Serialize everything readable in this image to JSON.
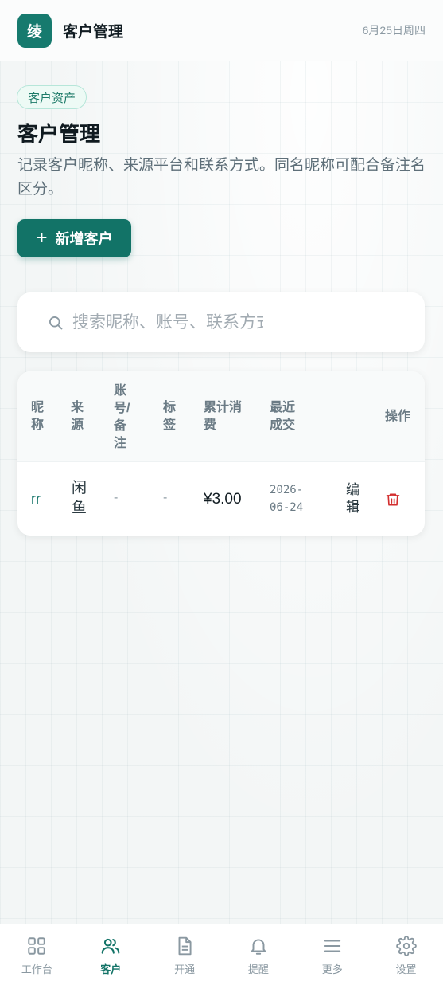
{
  "header": {
    "logo_text": "绫",
    "title": "客户管理",
    "date": "6月25日周四"
  },
  "page": {
    "badge": "客户资产",
    "title": "客户管理",
    "description": "记录客户昵称、来源平台和联系方式。同名昵称可配合备注名区分。",
    "add_button": "新增客户"
  },
  "search": {
    "placeholder": "搜索昵称、账号、联系方式"
  },
  "table": {
    "headers": {
      "nickname": [
        "昵",
        "称"
      ],
      "source": [
        "来",
        "源"
      ],
      "account": [
        "账",
        "号/",
        "备",
        "注"
      ],
      "tag": [
        "标",
        "签"
      ],
      "total": [
        "累计消",
        "费"
      ],
      "recent": [
        "最近",
        "成交"
      ],
      "action": "操作"
    },
    "rows": [
      {
        "nickname": "rr",
        "source": [
          "闲",
          "鱼"
        ],
        "account": "-",
        "tag": "-",
        "total": "¥3.00",
        "recent": [
          "2026-",
          "06-24"
        ],
        "edit": [
          "编",
          "辑"
        ]
      }
    ]
  },
  "nav": {
    "items": [
      {
        "label": "工作台",
        "icon": "grid-icon"
      },
      {
        "label": "客户",
        "icon": "users-icon",
        "active": true
      },
      {
        "label": "开通",
        "icon": "document-icon"
      },
      {
        "label": "提醒",
        "icon": "bell-icon"
      },
      {
        "label": "更多",
        "icon": "menu-icon"
      },
      {
        "label": "设置",
        "icon": "gear-icon"
      }
    ]
  },
  "colors": {
    "brand": "#127367",
    "danger": "#d32f2f",
    "badge_bg": "#edfaf5"
  }
}
